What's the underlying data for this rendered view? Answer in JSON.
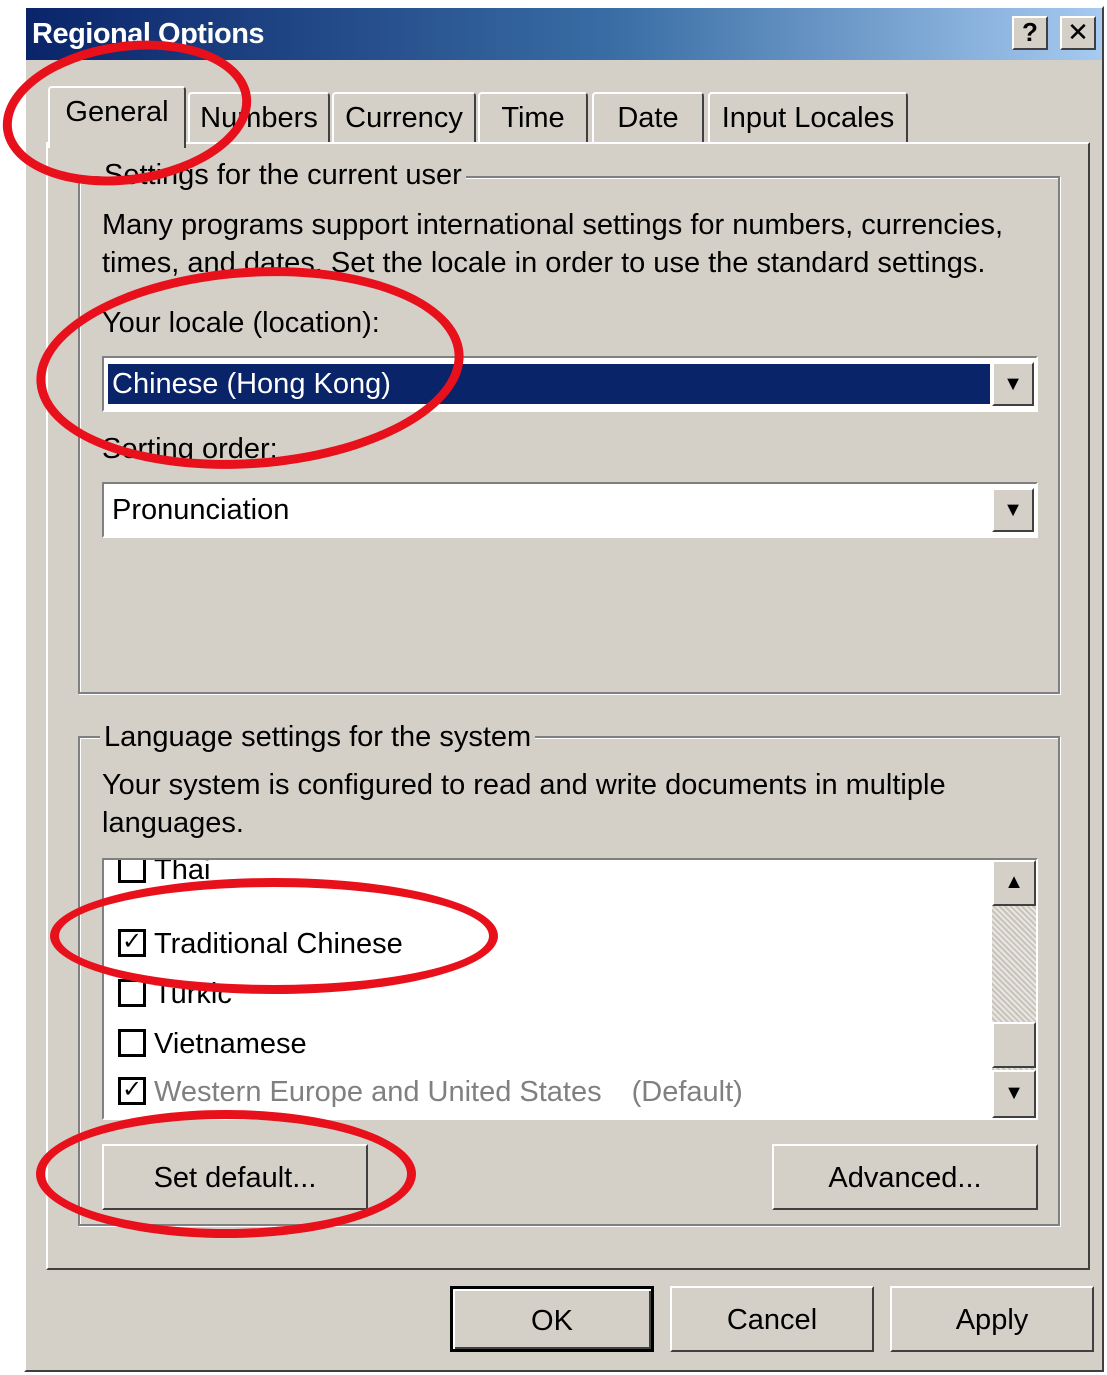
{
  "window": {
    "title": "Regional Options",
    "help_label": "?",
    "close_label": "✕"
  },
  "tabs": [
    {
      "label": "General",
      "active": true
    },
    {
      "label": "Numbers",
      "active": false
    },
    {
      "label": "Currency",
      "active": false
    },
    {
      "label": "Time",
      "active": false
    },
    {
      "label": "Date",
      "active": false
    },
    {
      "label": "Input Locales",
      "active": false
    }
  ],
  "user_settings": {
    "group_label": "Settings for the current user",
    "description_line1": "Many programs support international settings for numbers, currencies,",
    "description_line2": "times, and dates. Set the locale in order to use the standard settings.",
    "locale_label": "Your locale (location):",
    "locale_value": "Chinese (Hong Kong)",
    "sorting_label": "Sorting order:",
    "sorting_value": "Pronunciation"
  },
  "system_settings": {
    "group_label": "Language settings for the system",
    "description_line1": "Your system is configured to read and write documents in multiple",
    "description_line2": "languages.",
    "languages": [
      {
        "label": "Thai",
        "checked": false
      },
      {
        "label": "Traditional Chinese",
        "checked": true
      },
      {
        "label": "Turkic",
        "checked": false
      },
      {
        "label": "Vietnamese",
        "checked": false
      },
      {
        "label": "Western Europe and United States",
        "checked": true,
        "note": "(Default)"
      }
    ],
    "set_default_label": "Set default...",
    "advanced_label": "Advanced..."
  },
  "footer": {
    "ok_label": "OK",
    "cancel_label": "Cancel",
    "apply_label": "Apply"
  },
  "icons": {
    "dropdown_arrow": "▼",
    "scroll_up": "▲",
    "scroll_down": "▼",
    "checkmark": "✓"
  },
  "colors": {
    "highlight": "#0a246a",
    "annotation_ring": "#e8101a",
    "dialog_face": "#d4d0c8"
  }
}
